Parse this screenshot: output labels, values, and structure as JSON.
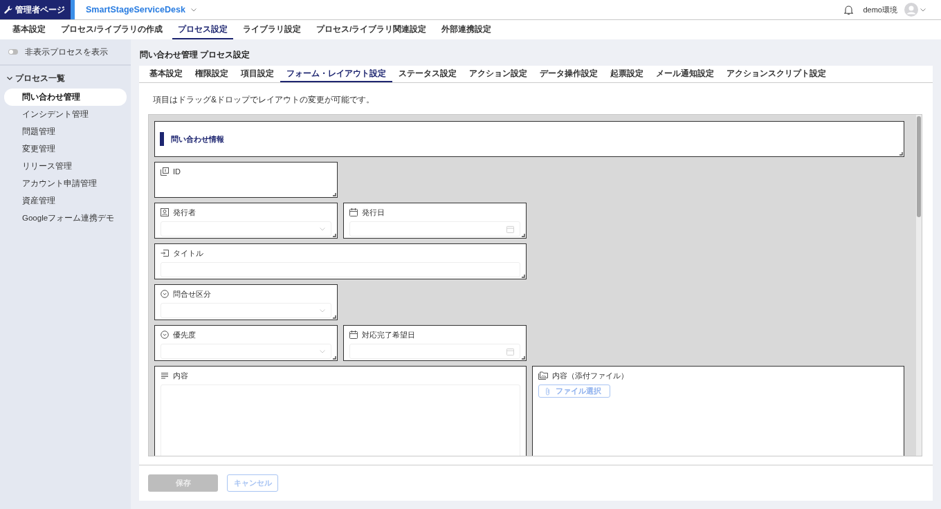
{
  "header": {
    "admin_label": "管理者ページ",
    "app_name": "SmartStageServiceDesk",
    "environment": "demo環境"
  },
  "top_tabs": [
    {
      "label": "基本設定",
      "selected": false
    },
    {
      "label": "プロセス/ライブラリの作成",
      "selected": false
    },
    {
      "label": "プロセス設定",
      "selected": true
    },
    {
      "label": "ライブラリ設定",
      "selected": false
    },
    {
      "label": "プロセス/ライブラリ関連設定",
      "selected": false
    },
    {
      "label": "外部連携設定",
      "selected": false
    }
  ],
  "sidebar": {
    "toggle": {
      "label": "非表示プロセスを表示",
      "on": false
    },
    "group": {
      "label": "プロセス一覧",
      "expanded": true
    },
    "items": [
      {
        "label": "問い合わせ管理",
        "selected": true
      },
      {
        "label": "インシデント管理",
        "selected": false
      },
      {
        "label": "問題管理",
        "selected": false
      },
      {
        "label": "変更管理",
        "selected": false
      },
      {
        "label": "リリース管理",
        "selected": false
      },
      {
        "label": "アカウント申請管理",
        "selected": false
      },
      {
        "label": "資産管理",
        "selected": false
      },
      {
        "label": "Googleフォーム連携デモ",
        "selected": false
      }
    ]
  },
  "page_title": "問い合わせ管理 プロセス設定",
  "settings_tabs": [
    {
      "label": "基本設定",
      "selected": false
    },
    {
      "label": "権限設定",
      "selected": false
    },
    {
      "label": "項目設定",
      "selected": false
    },
    {
      "label": "フォーム・レイアウト設定",
      "selected": true
    },
    {
      "label": "ステータス設定",
      "selected": false
    },
    {
      "label": "アクション設定",
      "selected": false
    },
    {
      "label": "データ操作設定",
      "selected": false
    },
    {
      "label": "起票設定",
      "selected": false
    },
    {
      "label": "メール通知設定",
      "selected": false
    },
    {
      "label": "アクションスクリプト設定",
      "selected": false
    }
  ],
  "instruction": "項目はドラッグ&ドロップでレイアウトの変更が可能です。",
  "layout_rows": [
    [
      {
        "kind": "section",
        "label": "問い合わせ情報"
      }
    ],
    [
      {
        "kind": "id",
        "label": "ID"
      }
    ],
    [
      {
        "kind": "user",
        "label": "発行者"
      },
      {
        "kind": "date",
        "label": "発行日"
      }
    ],
    [
      {
        "kind": "text",
        "label": "タイトル"
      }
    ],
    [
      {
        "kind": "select",
        "label": "問合せ区分"
      }
    ],
    [
      {
        "kind": "select",
        "label": "優先度"
      },
      {
        "kind": "date",
        "label": "対応完了希望日"
      }
    ],
    [
      {
        "kind": "textarea",
        "label": "内容"
      },
      {
        "kind": "file",
        "label": "内容（添付ファイル）",
        "button": "ファイル選択"
      }
    ]
  ],
  "buttons": [
    {
      "label": "保存",
      "kind": "primary",
      "disabled": true
    },
    {
      "label": "キャンセル",
      "kind": "secondary",
      "disabled": true
    }
  ]
}
